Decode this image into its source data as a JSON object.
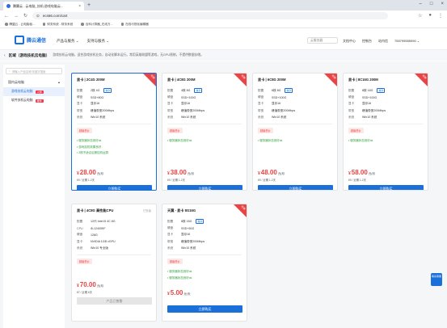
{
  "browser": {
    "tab_title": "腾翼云 - 云电脑_技机/游戏电脑云...",
    "url": "ecs66.com/cart",
    "bookmarks": [
      "腾翼云 - 云电脑租...",
      "财务系统 - 财务系统",
      "百科计算器_在线万...",
      "在线可视化编辑器"
    ]
  },
  "site": {
    "logo": "腾云通信",
    "nav": [
      "产品与服务 ⌄",
      "支持与服务 ⌄"
    ],
    "cloud_btn": "云服务器",
    "links": [
      "文档中心",
      "控制台",
      "站内信",
      "755799555990 ⌄"
    ]
  },
  "zone": {
    "back": "‹",
    "title": "区域（游戏技机云电脑）",
    "desc": "游戏技机云电脑，适合游戏技机业务，自动化脚本运行。常用英雄联盟等游戏，无GPU限制，不提供数据存储。"
  },
  "sidebar": {
    "search": "请输入产品名称/关键字搜索",
    "category": "国内云电脑",
    "items": [
      {
        "label": "游戏技机云电脑",
        "badge": "火爆"
      },
      {
        "label": "软件技机云电脑",
        "badge": "推荐"
      }
    ]
  },
  "cards": [
    {
      "title": "显卡 | 2C4G 200M",
      "status": "",
      "ribbon": "热销",
      "specs": [
        [
          "配置",
          "2核 4G",
          "独享"
        ],
        [
          "硬盘",
          "SSD+80G",
          ""
        ],
        [
          "显卡",
          "显存16",
          ""
        ],
        [
          "带宽",
          "峰值带宽200Mbps",
          ""
        ],
        [
          "系统",
          "Win10 系统",
          ""
        ]
      ],
      "promo": "超级低价",
      "feats": [
        "• 服务器状态良好ok",
        "• 游戏挂机效果良好",
        "• 2核不适合区服挂机运算"
      ],
      "price": "28.00",
      "unit": "元/月",
      "renew": "¥0 / 近期 1-2天",
      "button": "立即购买"
    },
    {
      "title": "显卡 | 4C8G 200M",
      "status": "",
      "ribbon": "热销",
      "specs": [
        [
          "配置",
          "4核 8G",
          "独享"
        ],
        [
          "硬盘",
          "SSD+100G",
          ""
        ],
        [
          "显卡",
          "显存16",
          ""
        ],
        [
          "带宽",
          "峰值带宽200Mbps",
          ""
        ],
        [
          "系统",
          "Win10 系统",
          ""
        ]
      ],
      "promo": "超级低价",
      "feats": [
        "• 服务器状态良好ok"
      ],
      "price": "38.00",
      "unit": "元/月",
      "renew": "¥0 / 近期 1-2天",
      "button": "立即购买"
    },
    {
      "title": "显卡 | 6C8G 200M",
      "status": "",
      "ribbon": "热销",
      "specs": [
        [
          "配置",
          "6核 8G",
          "独享"
        ],
        [
          "硬盘",
          "SSD+100G",
          ""
        ],
        [
          "显卡",
          "显存16",
          ""
        ],
        [
          "带宽",
          "峰值带宽200Mbps",
          ""
        ],
        [
          "系统",
          "Win10 系统",
          ""
        ]
      ],
      "promo": "超级低价",
      "feats": [
        "• 服务器状态良好ok"
      ],
      "price": "48.00",
      "unit": "元/月",
      "renew": "¥0 / 近期 1-2天",
      "button": "立即购买"
    },
    {
      "title": "显卡 | 8C16G 200M",
      "status": "",
      "ribbon": "热销",
      "specs": [
        [
          "配置",
          "8核 16G",
          "独享"
        ],
        [
          "硬盘",
          "SSD+100G",
          ""
        ],
        [
          "显卡",
          "显存16",
          ""
        ],
        [
          "带宽",
          "峰值带宽200Mbps",
          ""
        ],
        [
          "系统",
          "Win10 系统",
          ""
        ]
      ],
      "promo": "超级低价",
      "feats": [
        "• 服务器状态良好ok"
      ],
      "price": "58.00",
      "unit": "元/月",
      "renew": "¥0 / 近期 1-2天",
      "button": "立即购买"
    },
    {
      "title": "显卡 | 4C8G 高性能CPU",
      "status": "已售罄",
      "ribbon": "",
      "specs": [
        [
          "配置",
          "12代 Intel i5 4C 8G",
          ""
        ],
        [
          "CPU",
          "i5-12400KF",
          ""
        ],
        [
          "硬盘",
          "128G",
          ""
        ],
        [
          "显卡",
          "NVIDIA 1GB vGPU",
          ""
        ],
        [
          "系统",
          "Win10 专业版",
          ""
        ]
      ],
      "promo": "超级低价",
      "feats": [],
      "price": "70.00",
      "unit": "元/月",
      "renew": "¥7 / 近期 6天",
      "button": "产品已售罄",
      "disabled": true
    },
    {
      "title": "天翼 - 显卡 8G16G",
      "status": "",
      "ribbon": "热销",
      "specs": [
        [
          "配置",
          "8核 16G",
          "独享"
        ],
        [
          "硬盘",
          "SSD+50G",
          ""
        ],
        [
          "显卡",
          "显存16",
          ""
        ],
        [
          "带宽",
          "峰值带宽200Mbps",
          ""
        ],
        [
          "系统",
          "Win10 系统",
          ""
        ]
      ],
      "promo": "超级低价",
      "feats": [
        "• 服务器状态良好ok",
        "• 服务器状态良好ok"
      ],
      "price": "5.00",
      "unit": "元/天",
      "renew": "",
      "button": "立即购买"
    }
  ],
  "float_btn": "联系客服"
}
